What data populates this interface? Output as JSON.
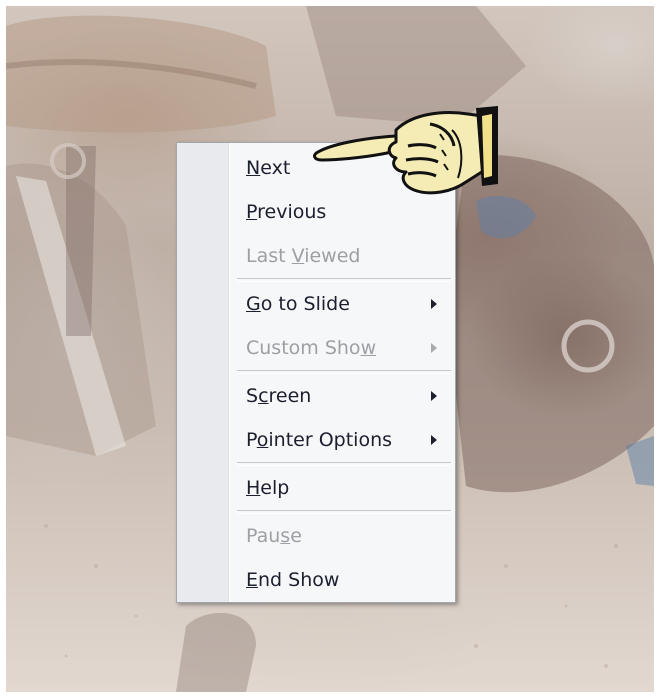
{
  "context_menu": {
    "items": [
      {
        "pre": "",
        "key": "N",
        "post": "ext",
        "enabled": true,
        "submenu": false
      },
      {
        "pre": "",
        "key": "P",
        "post": "revious",
        "enabled": true,
        "submenu": false
      },
      {
        "pre": "Last ",
        "key": "V",
        "post": "iewed",
        "enabled": false,
        "submenu": false
      },
      {
        "pre": "",
        "key": "G",
        "post": "o to Slide",
        "enabled": true,
        "submenu": true
      },
      {
        "pre": "Custom Sho",
        "key": "w",
        "post": "",
        "enabled": false,
        "submenu": true
      },
      {
        "pre": "S",
        "key": "c",
        "post": "reen",
        "enabled": true,
        "submenu": true
      },
      {
        "pre": "P",
        "key": "o",
        "post": "inter Options",
        "enabled": true,
        "submenu": true
      },
      {
        "pre": "",
        "key": "H",
        "post": "elp",
        "enabled": true,
        "submenu": false
      },
      {
        "pre": "Pau",
        "key": "s",
        "post": "e",
        "enabled": false,
        "submenu": false
      },
      {
        "pre": "",
        "key": "E",
        "post": "nd Show",
        "enabled": true,
        "submenu": false
      }
    ]
  },
  "cursor": {
    "icon": "pointing-hand-icon"
  },
  "colors": {
    "menu_text": "#1b1f2e",
    "menu_disabled": "#9d9fa4",
    "menu_bg": "#f6f7f9",
    "gutter": "#e9eaee"
  }
}
